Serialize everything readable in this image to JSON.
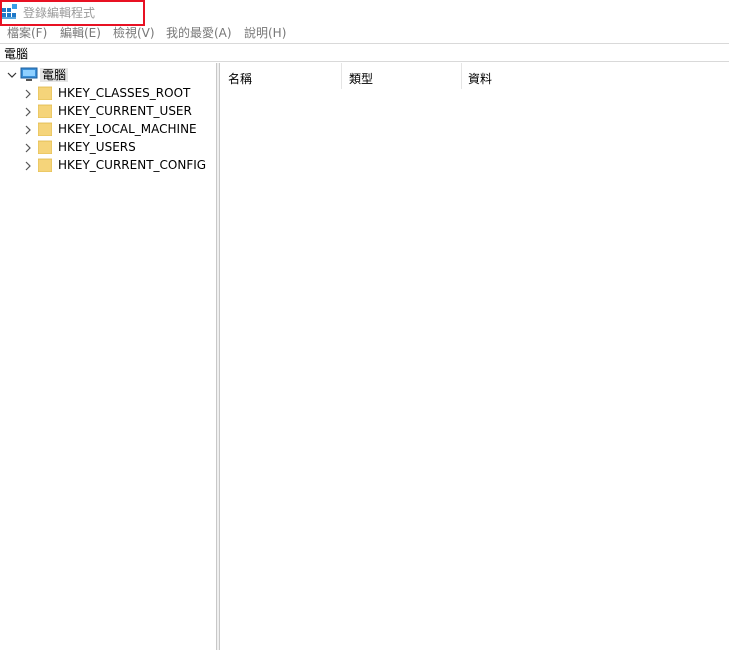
{
  "window": {
    "title": "登錄編輯程式",
    "icon": "registry-editor-icon"
  },
  "menu": [
    {
      "label": "檔案(F)"
    },
    {
      "label": "編輯(E)"
    },
    {
      "label": "檢視(V)"
    },
    {
      "label": "我的最愛(A)"
    },
    {
      "label": "說明(H)"
    }
  ],
  "address": {
    "path": "電腦"
  },
  "tree": {
    "root": {
      "label": "電腦",
      "expanded": true,
      "icon": "computer-icon"
    },
    "children": [
      {
        "label": "HKEY_CLASSES_ROOT",
        "icon": "folder-icon"
      },
      {
        "label": "HKEY_CURRENT_USER",
        "icon": "folder-icon"
      },
      {
        "label": "HKEY_LOCAL_MACHINE",
        "icon": "folder-icon"
      },
      {
        "label": "HKEY_USERS",
        "icon": "folder-icon"
      },
      {
        "label": "HKEY_CURRENT_CONFIG",
        "icon": "folder-icon"
      }
    ]
  },
  "list": {
    "columns": [
      {
        "label": "名稱"
      },
      {
        "label": "類型"
      },
      {
        "label": "資料"
      }
    ],
    "rows": []
  },
  "colors": {
    "highlight_border": "#e81123",
    "folder": "#f5d47a",
    "selected_bg": "#e5e5e5"
  }
}
